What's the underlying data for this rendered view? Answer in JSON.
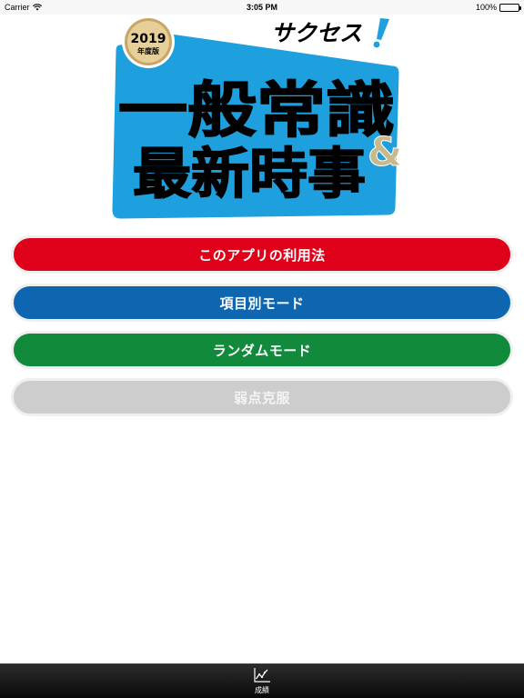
{
  "status_bar": {
    "carrier": "Carrier",
    "time": "3:05 PM",
    "battery": "100%",
    "battery_level": 1.0
  },
  "logo": {
    "badge_year": "2019",
    "badge_sub": "年度版",
    "series": "サクセス",
    "title_line1": "一般常識",
    "title_line2": "最新時事",
    "ampersand": "&",
    "colors": {
      "panel": "#1e9fde",
      "badge": "#c9a664",
      "ampersand": "#c8b98d",
      "text": "#000000"
    }
  },
  "menu": {
    "howto": "このアプリの利用法",
    "by_item": "項目別モード",
    "random": "ランダムモード",
    "weakness": "弱点克服"
  },
  "colors": {
    "howto": "#df0019",
    "by_item": "#0f66b0",
    "random": "#118a3c",
    "weakness": "#cdcdcd"
  },
  "tab_bar": {
    "results_label": "成績",
    "results_icon": "line-chart-icon"
  }
}
